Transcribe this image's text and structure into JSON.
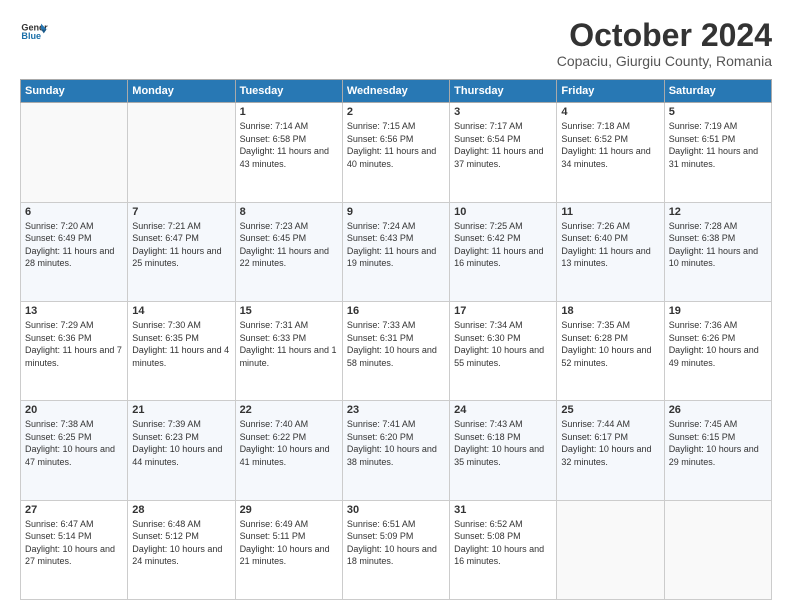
{
  "logo": {
    "line1": "General",
    "line2": "Blue"
  },
  "title": "October 2024",
  "subtitle": "Copaciu, Giurgiu County, Romania",
  "weekdays": [
    "Sunday",
    "Monday",
    "Tuesday",
    "Wednesday",
    "Thursday",
    "Friday",
    "Saturday"
  ],
  "weeks": [
    [
      {
        "day": "",
        "info": ""
      },
      {
        "day": "",
        "info": ""
      },
      {
        "day": "1",
        "info": "Sunrise: 7:14 AM\nSunset: 6:58 PM\nDaylight: 11 hours and 43 minutes."
      },
      {
        "day": "2",
        "info": "Sunrise: 7:15 AM\nSunset: 6:56 PM\nDaylight: 11 hours and 40 minutes."
      },
      {
        "day": "3",
        "info": "Sunrise: 7:17 AM\nSunset: 6:54 PM\nDaylight: 11 hours and 37 minutes."
      },
      {
        "day": "4",
        "info": "Sunrise: 7:18 AM\nSunset: 6:52 PM\nDaylight: 11 hours and 34 minutes."
      },
      {
        "day": "5",
        "info": "Sunrise: 7:19 AM\nSunset: 6:51 PM\nDaylight: 11 hours and 31 minutes."
      }
    ],
    [
      {
        "day": "6",
        "info": "Sunrise: 7:20 AM\nSunset: 6:49 PM\nDaylight: 11 hours and 28 minutes."
      },
      {
        "day": "7",
        "info": "Sunrise: 7:21 AM\nSunset: 6:47 PM\nDaylight: 11 hours and 25 minutes."
      },
      {
        "day": "8",
        "info": "Sunrise: 7:23 AM\nSunset: 6:45 PM\nDaylight: 11 hours and 22 minutes."
      },
      {
        "day": "9",
        "info": "Sunrise: 7:24 AM\nSunset: 6:43 PM\nDaylight: 11 hours and 19 minutes."
      },
      {
        "day": "10",
        "info": "Sunrise: 7:25 AM\nSunset: 6:42 PM\nDaylight: 11 hours and 16 minutes."
      },
      {
        "day": "11",
        "info": "Sunrise: 7:26 AM\nSunset: 6:40 PM\nDaylight: 11 hours and 13 minutes."
      },
      {
        "day": "12",
        "info": "Sunrise: 7:28 AM\nSunset: 6:38 PM\nDaylight: 11 hours and 10 minutes."
      }
    ],
    [
      {
        "day": "13",
        "info": "Sunrise: 7:29 AM\nSunset: 6:36 PM\nDaylight: 11 hours and 7 minutes."
      },
      {
        "day": "14",
        "info": "Sunrise: 7:30 AM\nSunset: 6:35 PM\nDaylight: 11 hours and 4 minutes."
      },
      {
        "day": "15",
        "info": "Sunrise: 7:31 AM\nSunset: 6:33 PM\nDaylight: 11 hours and 1 minute."
      },
      {
        "day": "16",
        "info": "Sunrise: 7:33 AM\nSunset: 6:31 PM\nDaylight: 10 hours and 58 minutes."
      },
      {
        "day": "17",
        "info": "Sunrise: 7:34 AM\nSunset: 6:30 PM\nDaylight: 10 hours and 55 minutes."
      },
      {
        "day": "18",
        "info": "Sunrise: 7:35 AM\nSunset: 6:28 PM\nDaylight: 10 hours and 52 minutes."
      },
      {
        "day": "19",
        "info": "Sunrise: 7:36 AM\nSunset: 6:26 PM\nDaylight: 10 hours and 49 minutes."
      }
    ],
    [
      {
        "day": "20",
        "info": "Sunrise: 7:38 AM\nSunset: 6:25 PM\nDaylight: 10 hours and 47 minutes."
      },
      {
        "day": "21",
        "info": "Sunrise: 7:39 AM\nSunset: 6:23 PM\nDaylight: 10 hours and 44 minutes."
      },
      {
        "day": "22",
        "info": "Sunrise: 7:40 AM\nSunset: 6:22 PM\nDaylight: 10 hours and 41 minutes."
      },
      {
        "day": "23",
        "info": "Sunrise: 7:41 AM\nSunset: 6:20 PM\nDaylight: 10 hours and 38 minutes."
      },
      {
        "day": "24",
        "info": "Sunrise: 7:43 AM\nSunset: 6:18 PM\nDaylight: 10 hours and 35 minutes."
      },
      {
        "day": "25",
        "info": "Sunrise: 7:44 AM\nSunset: 6:17 PM\nDaylight: 10 hours and 32 minutes."
      },
      {
        "day": "26",
        "info": "Sunrise: 7:45 AM\nSunset: 6:15 PM\nDaylight: 10 hours and 29 minutes."
      }
    ],
    [
      {
        "day": "27",
        "info": "Sunrise: 6:47 AM\nSunset: 5:14 PM\nDaylight: 10 hours and 27 minutes."
      },
      {
        "day": "28",
        "info": "Sunrise: 6:48 AM\nSunset: 5:12 PM\nDaylight: 10 hours and 24 minutes."
      },
      {
        "day": "29",
        "info": "Sunrise: 6:49 AM\nSunset: 5:11 PM\nDaylight: 10 hours and 21 minutes."
      },
      {
        "day": "30",
        "info": "Sunrise: 6:51 AM\nSunset: 5:09 PM\nDaylight: 10 hours and 18 minutes."
      },
      {
        "day": "31",
        "info": "Sunrise: 6:52 AM\nSunset: 5:08 PM\nDaylight: 10 hours and 16 minutes."
      },
      {
        "day": "",
        "info": ""
      },
      {
        "day": "",
        "info": ""
      }
    ]
  ]
}
